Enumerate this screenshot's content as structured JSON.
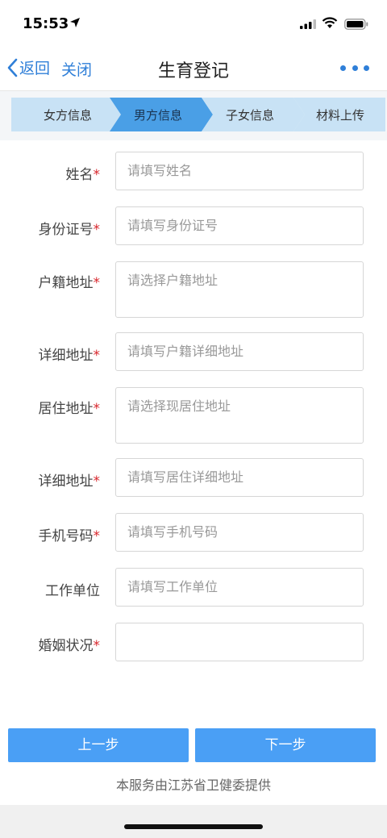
{
  "status": {
    "time": "15:53"
  },
  "nav": {
    "back_label": "返回",
    "close_label": "关闭",
    "title": "生育登记"
  },
  "steps": [
    {
      "label": "女方信息",
      "state": "done"
    },
    {
      "label": "男方信息",
      "state": "active"
    },
    {
      "label": "子女信息",
      "state": "todo"
    },
    {
      "label": "材料上传",
      "state": "todo"
    }
  ],
  "form": {
    "name": {
      "label": "姓名",
      "required_mark": "*",
      "placeholder": "请填写姓名"
    },
    "id_number": {
      "label": "身份证号",
      "required_mark": "*",
      "placeholder": "请填写身份证号"
    },
    "household_address": {
      "label": "户籍地址",
      "required_mark": "*",
      "placeholder": "请选择户籍地址"
    },
    "household_detail": {
      "label": "详细地址",
      "required_mark": "*",
      "placeholder": "请填写户籍详细地址"
    },
    "residence_address": {
      "label": "居住地址",
      "required_mark": "*",
      "placeholder": "请选择现居住地址"
    },
    "residence_detail": {
      "label": "详细地址",
      "required_mark": "*",
      "placeholder": "请填写居住详细地址"
    },
    "phone": {
      "label": "手机号码",
      "required_mark": "*",
      "placeholder": "请填写手机号码"
    },
    "workplace": {
      "label": "工作单位",
      "placeholder": "请填写工作单位"
    },
    "marital_status": {
      "label": "婚姻状况",
      "required_mark": "*",
      "value": ""
    }
  },
  "footer": {
    "prev_label": "上一步",
    "next_label": "下一步",
    "provider_text": "本服务由江苏省卫健委提供"
  },
  "colors": {
    "accent": "#2f7fd8",
    "step_active": "#4a9fe6",
    "step_inactive": "#c8e2f5",
    "button": "#4a9ff5",
    "required": "#d8262c"
  }
}
